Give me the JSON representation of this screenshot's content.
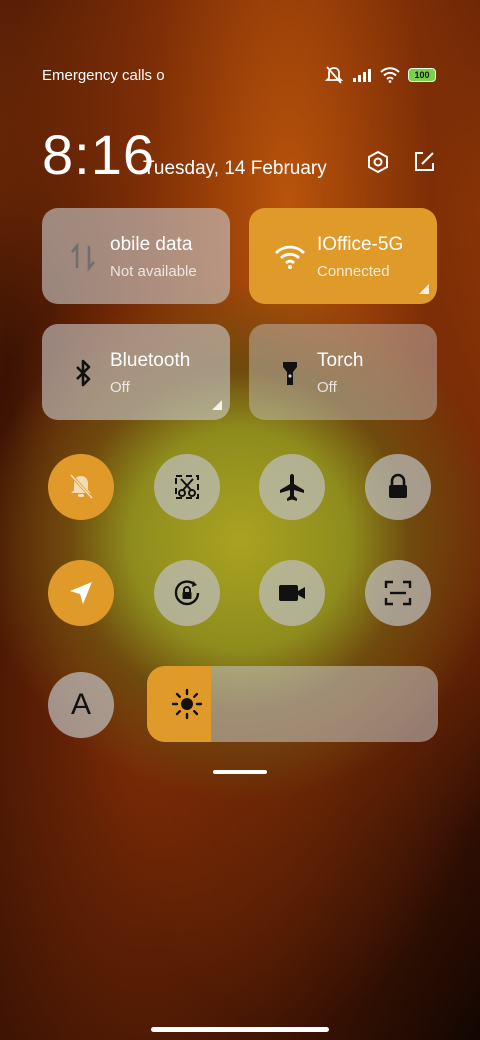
{
  "status_bar": {
    "carrier": "Emergency calls o",
    "battery": "100"
  },
  "header": {
    "time": "8:16",
    "date": "Tuesday, 14 February"
  },
  "tiles": [
    {
      "title": "obile data",
      "subtitle": "Not available",
      "icon": "mobile-data-icon",
      "on": false
    },
    {
      "title": "IOffice-5G",
      "subtitle": "Connected",
      "icon": "wifi-icon",
      "on": true
    },
    {
      "title": "Bluetooth",
      "subtitle": "Off",
      "icon": "bluetooth-icon",
      "on": false
    },
    {
      "title": "Torch",
      "subtitle": "Off",
      "icon": "torch-icon",
      "on": false
    }
  ],
  "toggles": [
    {
      "name": "silent-mode",
      "icon": "bell-off-icon",
      "on": true
    },
    {
      "name": "screenshot",
      "icon": "scissors-icon",
      "on": false
    },
    {
      "name": "airplane-mode",
      "icon": "airplane-icon",
      "on": false
    },
    {
      "name": "lock-screen",
      "icon": "lock-icon",
      "on": false
    },
    {
      "name": "location",
      "icon": "location-arrow-icon",
      "on": true
    },
    {
      "name": "rotation-lock",
      "icon": "rotation-lock-icon",
      "on": false
    },
    {
      "name": "screen-recorder",
      "icon": "video-camera-icon",
      "on": false
    },
    {
      "name": "scanner",
      "icon": "scan-icon",
      "on": false
    }
  ],
  "auto_brightness": {
    "label": "A"
  },
  "brightness_level": 0.22,
  "colors": {
    "accent": "#e09a2a",
    "tile_off": "#c8c8c8"
  }
}
